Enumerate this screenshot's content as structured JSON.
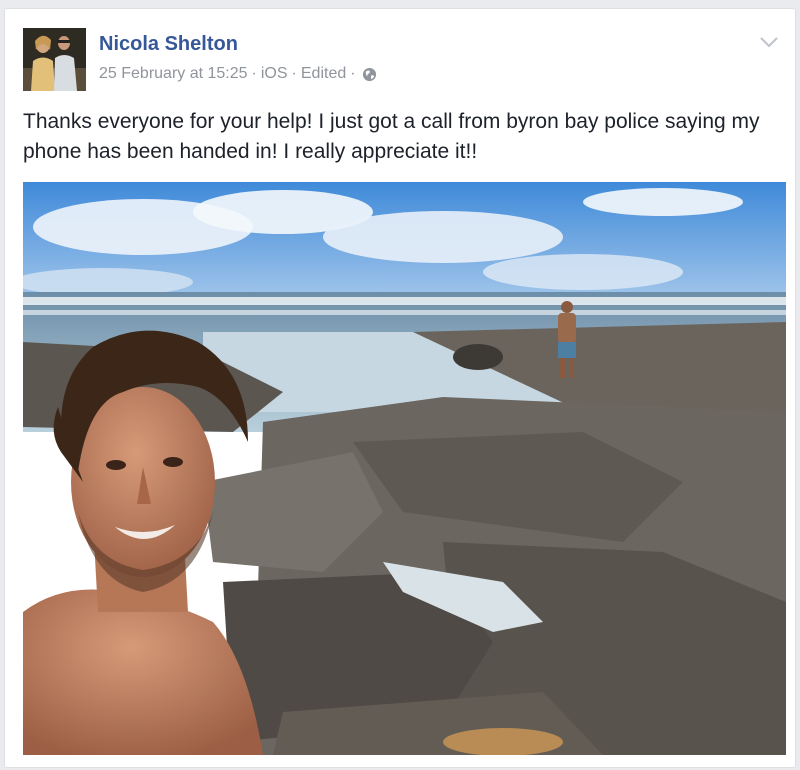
{
  "post": {
    "author_name": "Nicola Shelton",
    "date": "25 February at 15:25",
    "source": "iOS",
    "edited_label": "Edited",
    "separator": "·",
    "privacy_icon": "globe-icon",
    "options_icon": "chevron-down-icon",
    "text": "Thanks everyone for your help! I just got a call from byron bay police saying my phone has been handed in! I really appreciate it!!"
  },
  "colors": {
    "author": "#365899",
    "meta": "#90949c",
    "text": "#1d2129",
    "background": "#e9ebee"
  }
}
